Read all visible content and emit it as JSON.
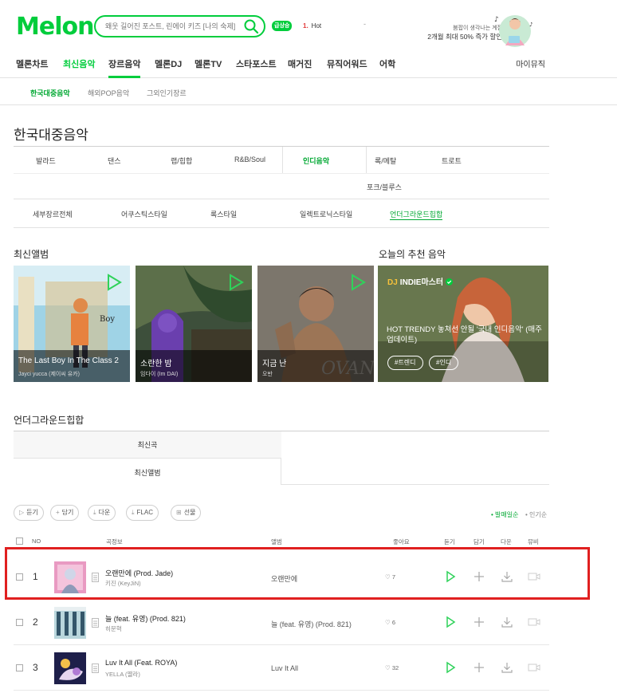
{
  "header": {
    "logo": "Melon",
    "search_placeholder": "왜웃 길어진 포스트, 린에이 키즈 [나의 숙제]",
    "rise_badge": "급상승",
    "hot_rank_num": "1.",
    "hot_rank_text": "Hot",
    "hot_dash": "-",
    "promo_line1": "붐팝이 생각나는 계절",
    "promo_line2": "2개월 최대 50% 즉가 할인"
  },
  "gnb": {
    "items": [
      "멜론차트",
      "최신음악",
      "장르음악",
      "멜론DJ",
      "멜론TV",
      "스타포스트",
      "매거진",
      "뮤직어워드",
      "어학"
    ],
    "mymusic": "마이뮤직"
  },
  "subnav": {
    "items": [
      "한국대중음악",
      "해외POP음악",
      "그외인기장르"
    ]
  },
  "page_title": "한국대중음악",
  "genres": {
    "row1": [
      "발라드",
      "댄스",
      "랩/힙합",
      "R&B/Soul",
      "인디음악",
      "록/메탈",
      "트로트"
    ],
    "row2": [
      "포크/블루스"
    ],
    "sub": [
      "세부장르전체",
      "어쿠스틱스타일",
      "록스타일",
      "일렉트로닉스타일",
      "언더그라운드힙합"
    ]
  },
  "new_albums": {
    "title": "최신앨범",
    "items": [
      {
        "title": "The Last Boy In The Class 2",
        "artist": "Jayci yucca (제이씨 유카)"
      },
      {
        "title": "소란한 밤",
        "artist": "임다이 (Im DAI)"
      },
      {
        "title": "지금 난",
        "artist": "오반"
      }
    ]
  },
  "recommend": {
    "title": "오늘의 추천 음악",
    "dj_label": "DJ",
    "dj_name": "INDIE마스터",
    "headline": "HOT TRENDY 놓쳐선 안될 '국내 인디음악' (매주 업데이트)",
    "tags": [
      "#트렌디",
      "#인디"
    ]
  },
  "underground": {
    "title": "언더그라운드힙합",
    "tab1": "최신곡",
    "tab2": "최신앨범"
  },
  "toolbar": {
    "listen": "듣기",
    "add": "담기",
    "download": "다운",
    "flac": "FLAC",
    "gift": "선물",
    "sort_recent": "발매일순",
    "sort_popular": "인기순"
  },
  "table": {
    "headers": {
      "no": "NO",
      "song": "곡정보",
      "album": "앨범",
      "like": "좋아요",
      "listen": "듣기",
      "add": "담기",
      "download": "다운",
      "mv": "뮤비"
    },
    "rows": [
      {
        "rank": "1",
        "song": "오랜만에 (Prod. Jade)",
        "artist": "키진 (KeyJiN)",
        "album": "오랜만에",
        "likes": "7"
      },
      {
        "rank": "2",
        "song": "늘 (feat. 유영) (Prod. 821)",
        "artist": "히문혁",
        "album": "늘 (feat. 유영) (Prod. 821)",
        "likes": "6"
      },
      {
        "rank": "3",
        "song": "Luv It All (Feat. ROYA)",
        "artist": "YELLA (옐라)",
        "album": "Luv It All",
        "likes": "32"
      }
    ]
  },
  "colors": {
    "brand": "#00cd3c",
    "highlight": "#e02020"
  }
}
